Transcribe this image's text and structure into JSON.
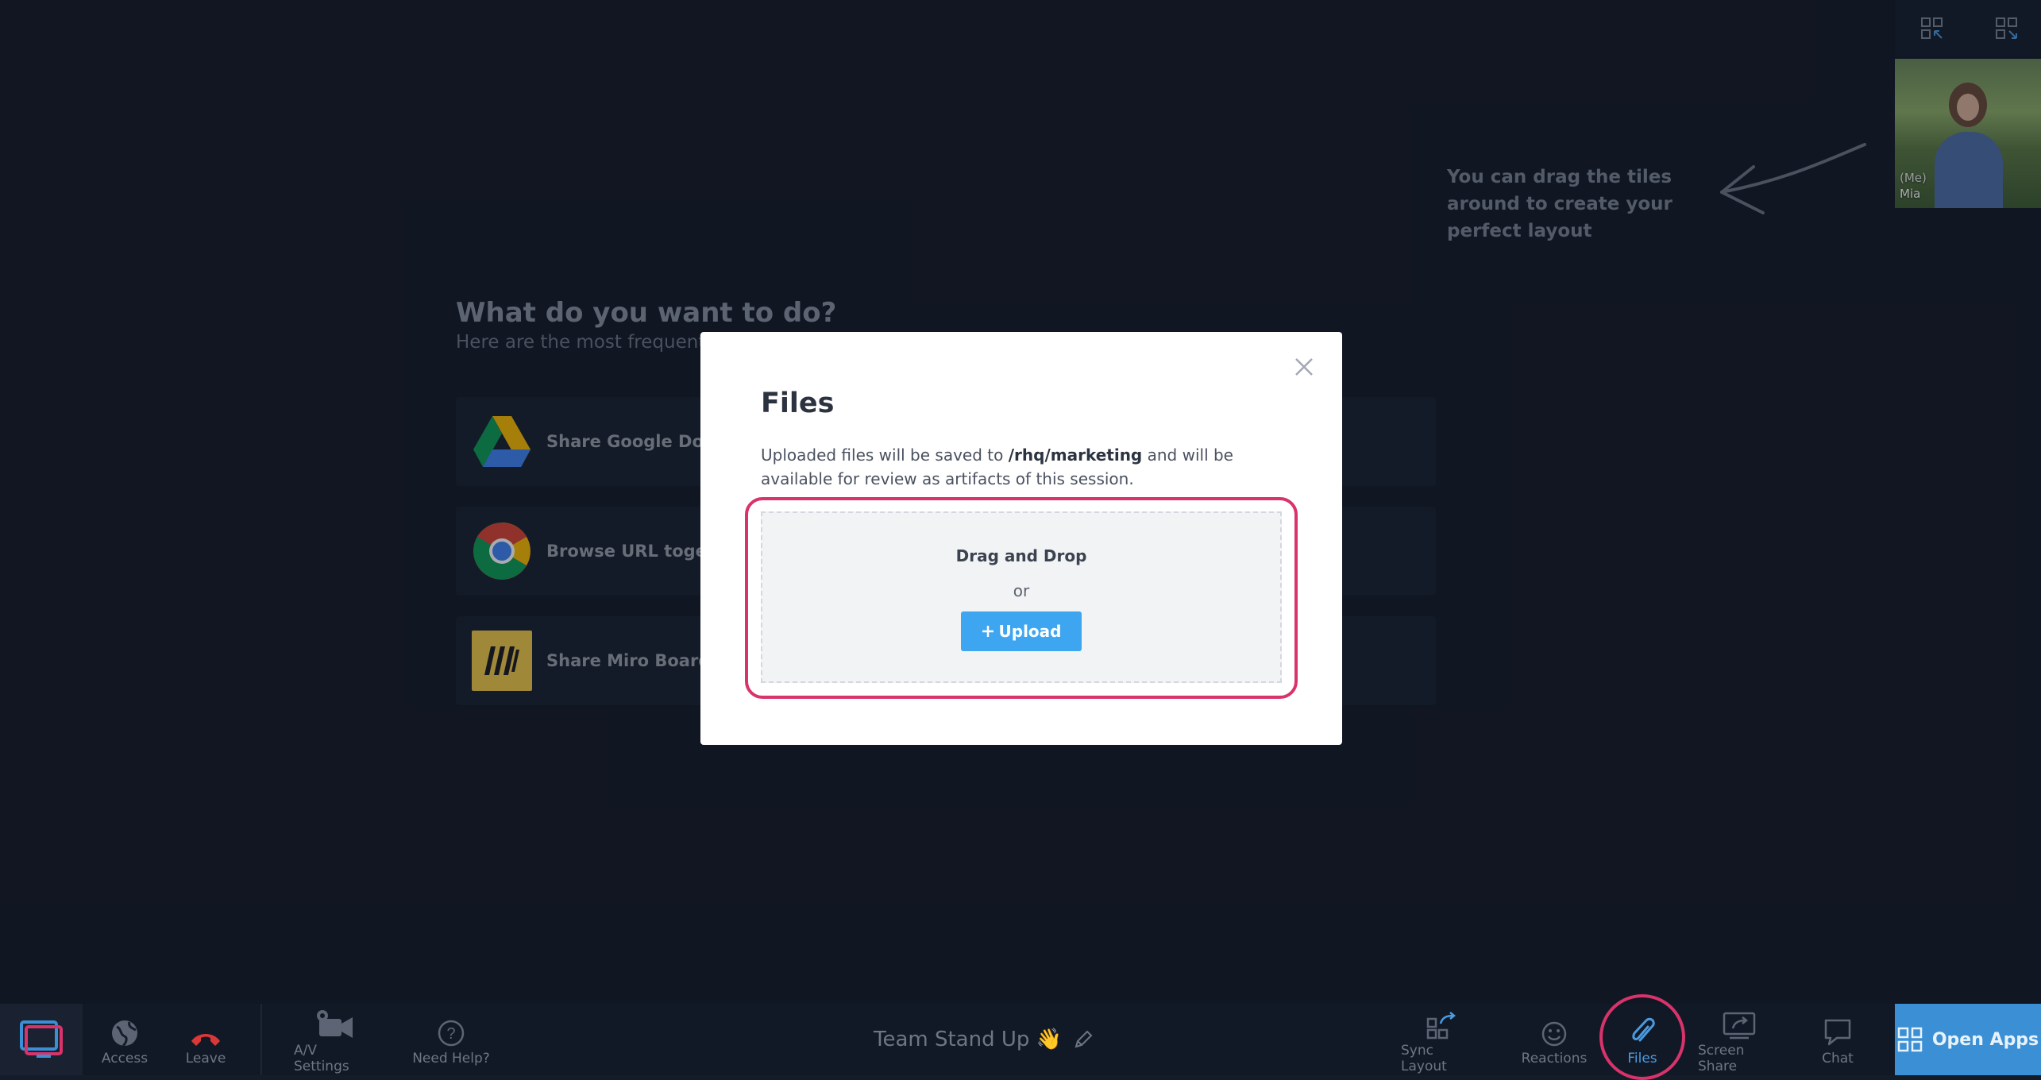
{
  "top_controls": {
    "layout_toggle_1_icon": "grid-collapse-icon",
    "layout_toggle_2_icon": "grid-expand-icon"
  },
  "self_tile": {
    "me_label": "(Me)",
    "name": "Mia"
  },
  "hint": {
    "text": "You can drag the tiles around to create your perfect layout"
  },
  "background": {
    "heading": "What do you want to do?",
    "subheading": "Here are the most frequently",
    "actions": [
      {
        "label": "Share Google Docum",
        "icon": "google-drive-icon"
      },
      {
        "label": "Browse URL together",
        "icon": "chrome-icon"
      },
      {
        "label": "Share Miro Board",
        "icon": "miro-icon"
      }
    ]
  },
  "modal": {
    "title": "Files",
    "desc_prefix": "Uploaded files will be saved to ",
    "desc_path": "/rhq/marketing",
    "desc_suffix": " and will be available for review as artifacts of this session.",
    "drop_title": "Drag and Drop",
    "drop_or": "or",
    "upload_label": "Upload",
    "close_icon": "close-icon"
  },
  "toolbar": {
    "access": "Access",
    "leave": "Leave",
    "av_settings": "A/V Settings",
    "need_help": "Need Help?",
    "meeting_title": "Team Stand Up 👋",
    "sync_layout": "Sync Layout",
    "reactions": "Reactions",
    "files": "Files",
    "screen_share": "Screen Share",
    "chat": "Chat",
    "open_apps": "Open Apps"
  },
  "colors": {
    "background": "#141b29",
    "accent_blue": "#3ea6f0",
    "highlight_pink": "#d8336b",
    "open_apps_bg": "#3b8fd4"
  }
}
